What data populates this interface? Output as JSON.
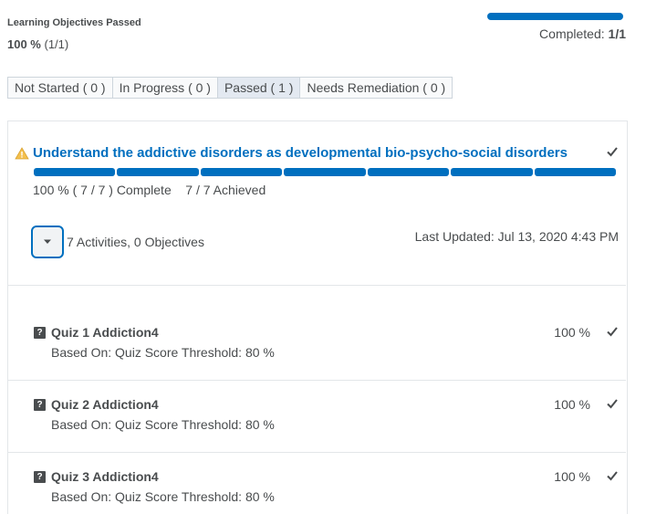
{
  "header": {
    "section_title": "Learning Objectives Passed",
    "percent": "100 %",
    "fraction": "(1/1)",
    "completed_label": "Completed:",
    "completed_value": "1/1",
    "progress_fraction": 1.0
  },
  "filters": [
    {
      "label": "Not Started ( 0 )",
      "active": false
    },
    {
      "label": "In Progress ( 0 )",
      "active": false
    },
    {
      "label": "Passed ( 1 )",
      "active": true
    },
    {
      "label": "Needs Remediation ( 0 )",
      "active": false
    }
  ],
  "objective": {
    "title": "Understand the addictive disorders as developmental bio-psycho-social disorders",
    "status_icon": "warning-triangle-icon",
    "check_icon": "checkmark-icon",
    "segments_completed": 7,
    "segments_total": 7,
    "status_text": "100 % ( 7 / 7 ) Complete    7 / 7 Achieved",
    "toggle_icon": "caret-down-icon",
    "activities_text": "7 Activities, 0 Objectives",
    "last_updated": "Last Updated: Jul 13, 2020 4:43 PM"
  },
  "activities": [
    {
      "title": "Quiz 1 Addiction4",
      "based_on": "Based On:  Quiz Score  Threshold: 80 %",
      "score": "100 %"
    },
    {
      "title": "Quiz 2 Addiction4",
      "based_on": "Based On:  Quiz Score  Threshold: 80 %",
      "score": "100 %"
    },
    {
      "title": "Quiz 3 Addiction4",
      "based_on": "Based On:  Quiz Score  Threshold: 80 %",
      "score": "100 %"
    }
  ],
  "colors": {
    "accent": "#006fbf",
    "text": "#494c4e",
    "warning": "#f4c04e",
    "border": "#e3e6e9"
  }
}
